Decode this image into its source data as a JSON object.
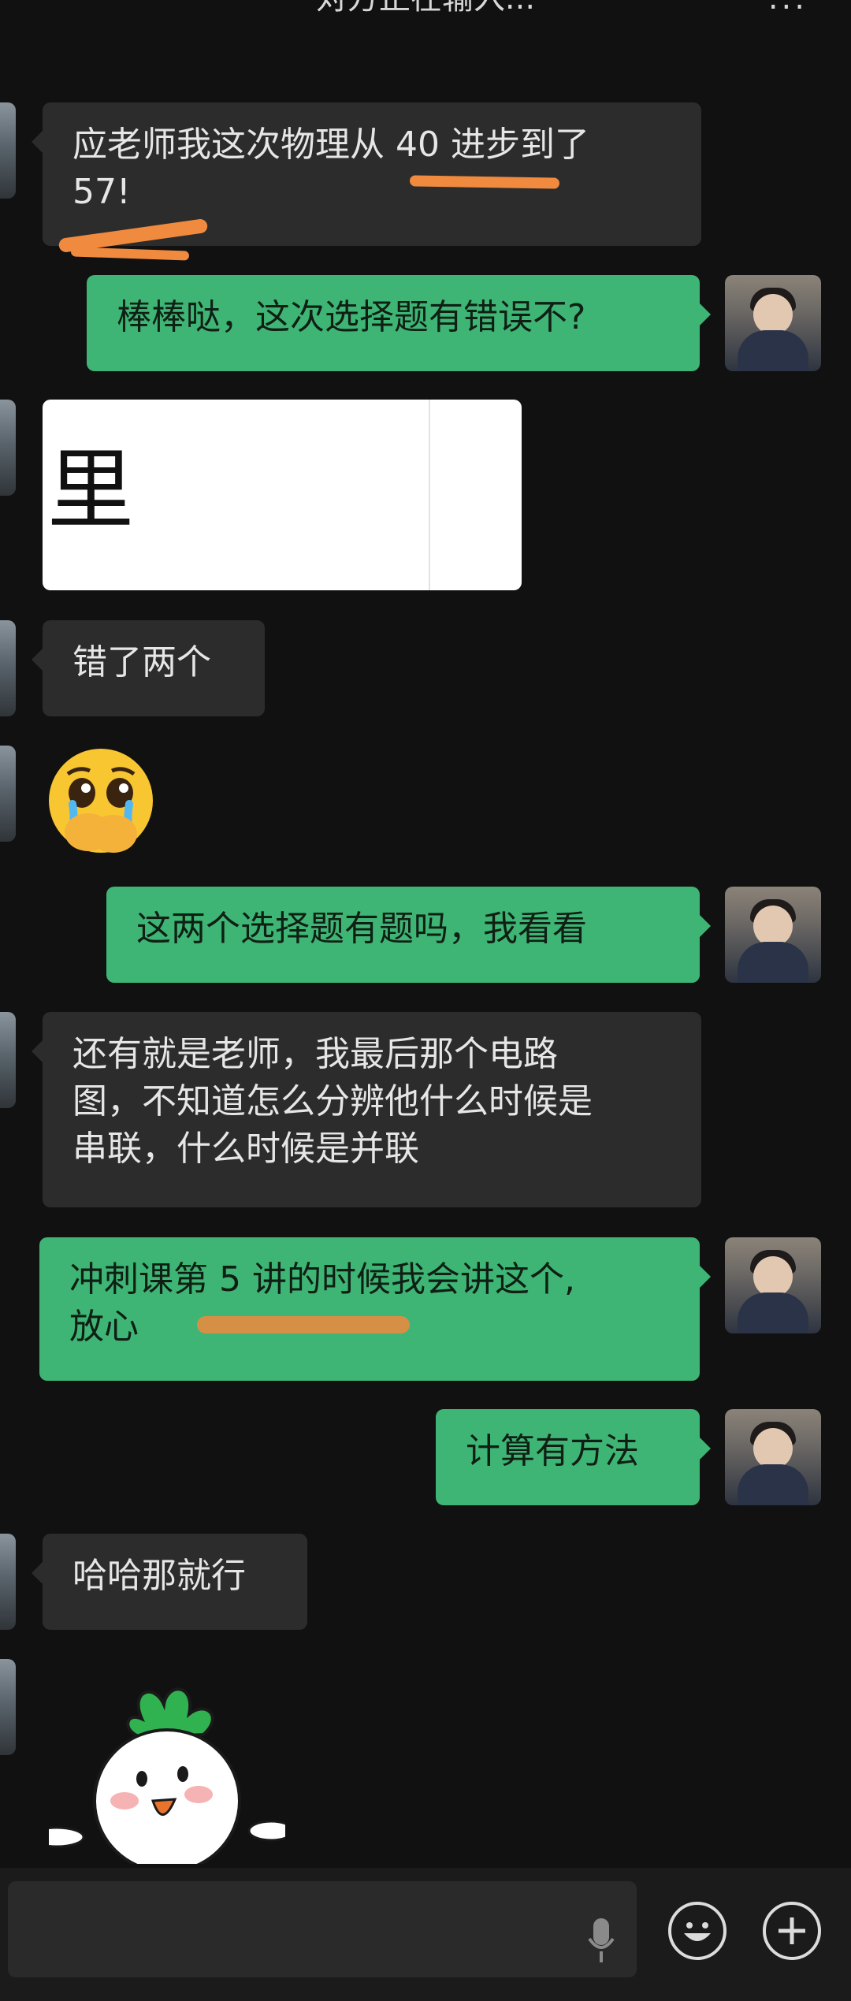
{
  "header": {
    "title": "对方正在输入...",
    "more": "..."
  },
  "messages": [
    {
      "id": 1,
      "side": "peer",
      "lines": "应老师我这次物理从 40 进步到了\n57!"
    },
    {
      "id": 2,
      "side": "mine",
      "lines": "棒棒哒，这次选择题有错误不?"
    },
    {
      "id": 3,
      "side": "peer",
      "type": "image",
      "glyph": "里"
    },
    {
      "id": 4,
      "side": "peer",
      "lines": "错了两个"
    },
    {
      "id": 5,
      "side": "peer",
      "type": "emoji",
      "emoji": "pleading-face-crying-emoji"
    },
    {
      "id": 6,
      "side": "mine",
      "lines": "这两个选择题有题吗，我看看"
    },
    {
      "id": 7,
      "side": "peer",
      "lines": "还有就是老师，我最后那个电路\n图，不知道怎么分辨他什么时候是\n串联，什么时候是并联"
    },
    {
      "id": 8,
      "side": "mine",
      "lines": "冲刺课第 5 讲的时候我会讲这个,\n放心"
    },
    {
      "id": 9,
      "side": "mine",
      "lines": "计算有方法"
    },
    {
      "id": 10,
      "side": "peer",
      "lines": "哈哈那就行"
    },
    {
      "id": 11,
      "side": "peer",
      "type": "sticker",
      "sticker": "radish-sticker"
    }
  ],
  "input_bar": {
    "icons": [
      "voice-mic-icon",
      "emoji-icon",
      "add-plus-icon"
    ]
  },
  "colors": {
    "background": "#111111",
    "peer_bubble": "#2c2c2c",
    "my_bubble": "#3eb575",
    "highlight": "#f08a3e"
  }
}
